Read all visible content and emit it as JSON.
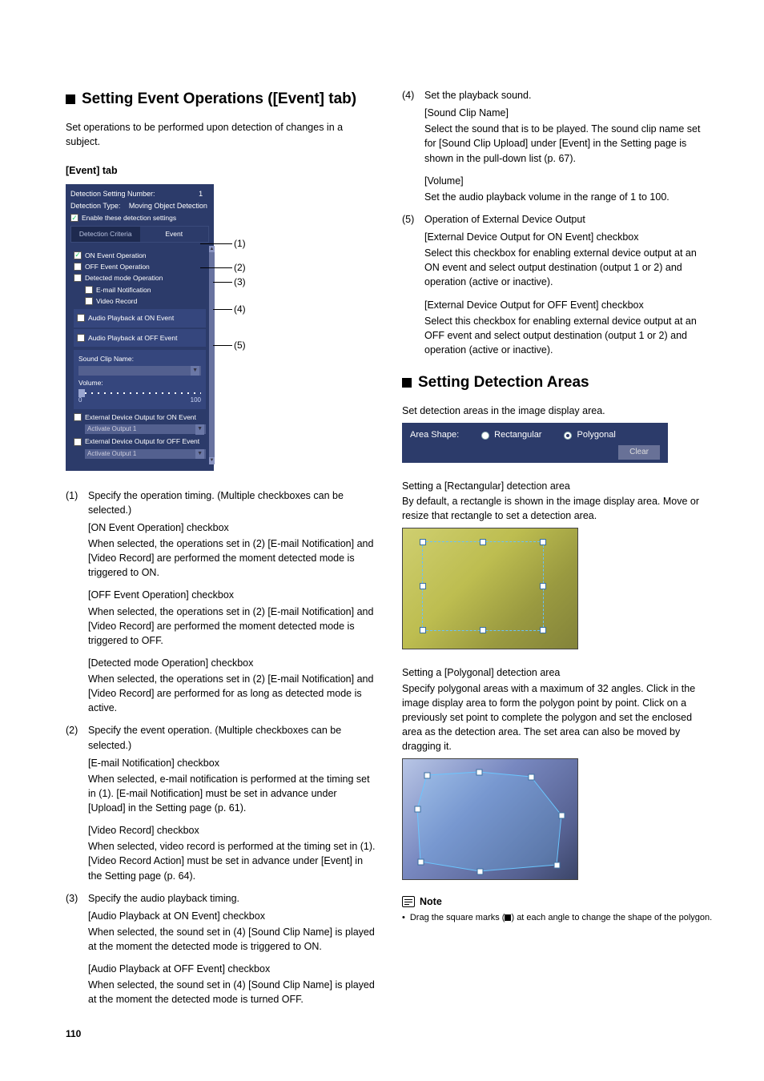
{
  "left": {
    "h1": "Setting Event Operations ([Event] tab)",
    "intro": "Set operations to be performed upon detection of changes in a subject.",
    "tabhdr": "[Event] tab",
    "panel": {
      "dsn_lbl": "Detection Setting Number:",
      "dsn_val": "1",
      "dt_lbl": "Detection Type:",
      "dt_val": "Moving Object Detection",
      "enable": "Enable these detection settings",
      "tab1": "Detection Criteria",
      "tab2": "Event",
      "cb1": "ON Event Operation",
      "cb2": "OFF Event Operation",
      "cb3": "Detected mode Operation",
      "cb4": "E-mail Notification",
      "cb5": "Video Record",
      "ap_on": "Audio Playback at ON Event",
      "ap_off": "Audio Playback at OFF Event",
      "scn": "Sound Clip Name:",
      "vol": "Volume:",
      "s0": "0",
      "s100": "100",
      "edon": "External Device Output for ON Event",
      "act1": "Activate Output 1",
      "edoff": "External Device Output for OFF Event",
      "act2": "Activate Output 1"
    },
    "c1": "(1)",
    "c2": "(2)",
    "c3": "(3)",
    "c4": "(4)",
    "c5": "(5)",
    "n1": "(1)",
    "n1txt": "Specify the operation timing. (Multiple checkboxes can be selected.)",
    "n1a_h": "[ON Event Operation] checkbox",
    "n1a_t": "When selected, the operations set in (2) [E-mail Notification] and [Video Record] are performed the moment detected mode is triggered to ON.",
    "n1b_h": "[OFF Event Operation] checkbox",
    "n1b_t": "When selected, the operations set in (2) [E-mail Notification] and [Video Record] are performed the moment detected mode is triggered to OFF.",
    "n1c_h": "[Detected mode Operation] checkbox",
    "n1c_t": "When selected, the operations set in (2) [E-mail Notification] and [Video Record] are performed for as long as detected mode is active.",
    "n2": "(2)",
    "n2txt": "Specify the event operation. (Multiple checkboxes can be selected.)",
    "n2a_h": "[E-mail Notification] checkbox",
    "n2a_t": "When selected, e-mail notification is performed at the timing set in (1). [E-mail Notification] must be set in advance under [Upload] in the Setting page (p. 61).",
    "n2b_h": "[Video Record] checkbox",
    "n2b_t": "When selected, video record is performed at the timing set in (1). [Video Record Action] must be set in advance under [Event] in the Setting page (p. 64).",
    "n3": "(3)",
    "n3txt": "Specify the audio playback timing.",
    "n3a_h": "[Audio Playback at ON Event] checkbox",
    "n3a_t": "When selected, the sound set in (4) [Sound Clip Name] is played at the moment the detected mode is triggered to ON.",
    "n3b_h": "[Audio Playback at OFF Event] checkbox",
    "n3b_t": "When selected, the sound set in (4)  [Sound Clip Name] is played at the moment the detected mode is turned OFF."
  },
  "right": {
    "n4": "(4)",
    "n4txt": "Set the playback sound.",
    "n4a_h": "[Sound Clip Name]",
    "n4a_t": "Select the sound that is to be played. The sound clip name set for [Sound Clip Upload] under [Event] in the Setting page is shown in the pull-down list (p. 67).",
    "n4b_h": "[Volume]",
    "n4b_t": "Set the audio playback volume in the range of 1 to 100.",
    "n5": "(5)",
    "n5txt": "Operation of External Device Output",
    "n5a_h": "[External Device Output for ON Event] checkbox",
    "n5a_t": "Select this checkbox for enabling external device output at an ON event and select output destination (output 1 or 2) and operation (active or inactive).",
    "n5b_h": "[External Device Output for OFF Event] checkbox",
    "n5b_t": "Select this checkbox for enabling external device output at an OFF event and select output destination (output 1 or 2) and operation (active or inactive).",
    "h2": "Setting Detection Areas",
    "intro2": "Set detection areas in the image display area.",
    "areabar": {
      "lbl": "Area Shape:",
      "r1": "Rectangular",
      "r2": "Polygonal",
      "clear": "Clear"
    },
    "rect_h": "Setting a [Rectangular] detection area",
    "rect_t": "By default, a rectangle is shown in the image display area. Move or resize that rectangle to set a detection area.",
    "poly_h": "Setting a [Polygonal] detection area",
    "poly_t": "Specify polygonal areas with a maximum of 32 angles. Click in the image display area to form the polygon point by point. Click on a previously set point to complete the polygon and set the enclosed area as the detection area. The set area can also be moved by dragging it.",
    "note": "Note",
    "note1a": "Drag the square marks (",
    "note1b": ") at each angle to change the shape of the polygon."
  },
  "page": "110"
}
